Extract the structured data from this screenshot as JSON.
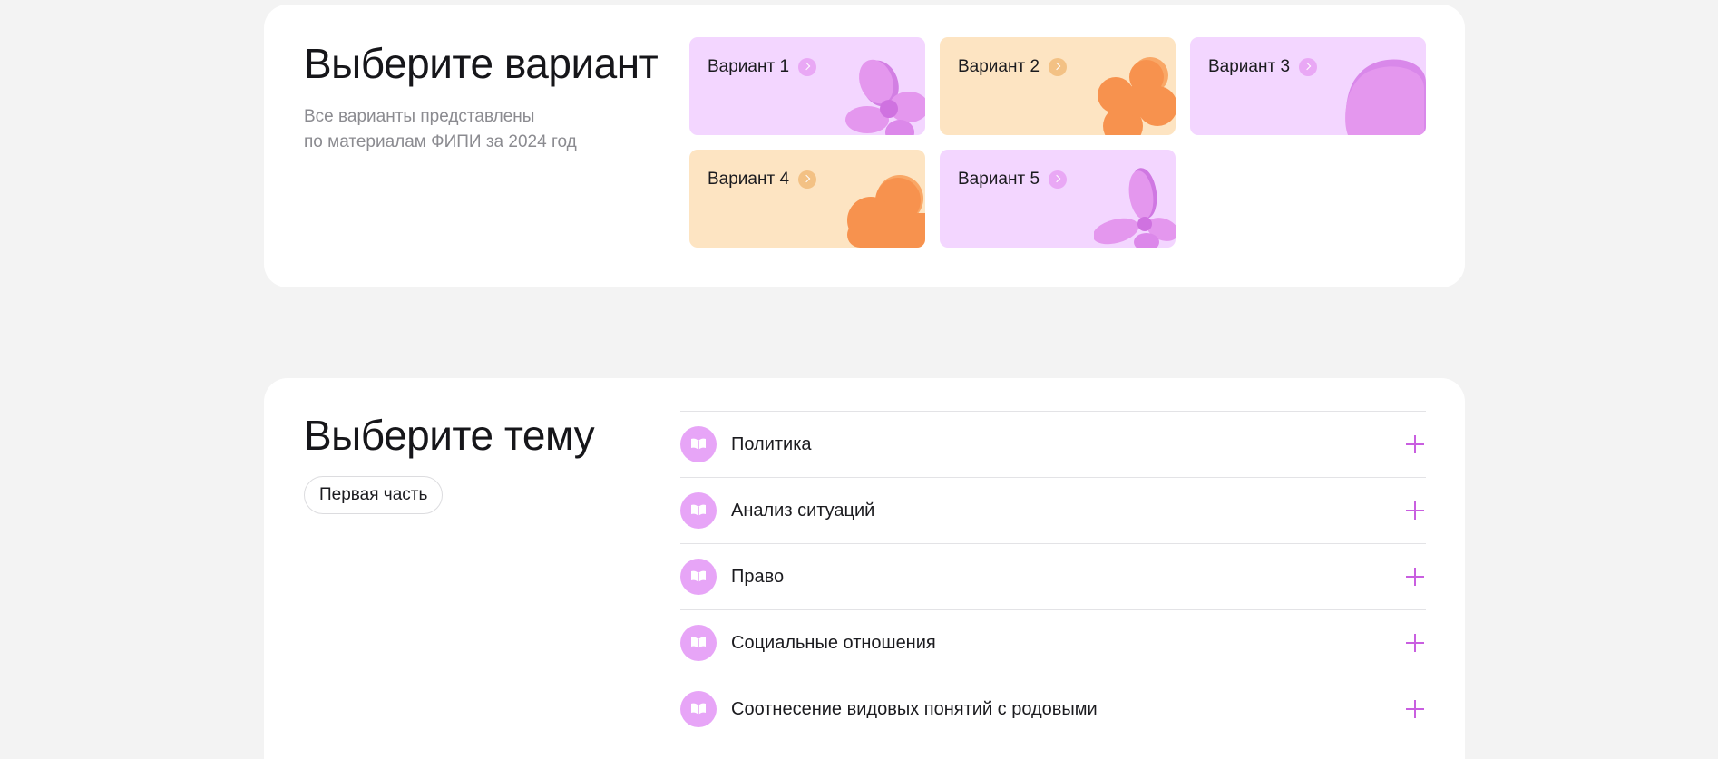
{
  "variants": {
    "title": "Выберите вариант",
    "subtitle_line1": "Все варианты представлены",
    "subtitle_line2": "по материалам ФИПИ за 2024 год",
    "tiles": [
      {
        "label": "Вариант 1",
        "theme": "pink",
        "shape": "flower-icon"
      },
      {
        "label": "Вариант 2",
        "theme": "peach",
        "shape": "flower-icon"
      },
      {
        "label": "Вариант 3",
        "theme": "pink",
        "shape": "blob-icon"
      },
      {
        "label": "Вариант 4",
        "theme": "peach",
        "shape": "cloud-icon"
      },
      {
        "label": "Вариант 5",
        "theme": "pink",
        "shape": "clover-icon"
      }
    ]
  },
  "topics": {
    "title": "Выберите тему",
    "filter_label": "Первая часть",
    "items": [
      {
        "label": "Политика",
        "icon": "book-icon"
      },
      {
        "label": "Анализ ситуаций",
        "icon": "book-icon"
      },
      {
        "label": "Право",
        "icon": "book-icon"
      },
      {
        "label": "Социальные отношения",
        "icon": "book-icon"
      },
      {
        "label": "Соотнесение видовых понятий с родовыми",
        "icon": "book-icon"
      }
    ]
  },
  "colors": {
    "page_bg": "#f3f3f3",
    "card_bg": "#ffffff",
    "tile_pink": "#f3d6ff",
    "tile_peach": "#fde4c2",
    "shape_pink": "#e497ee",
    "shape_orange": "#f7924e",
    "accent_purple": "#c95fe0",
    "icon_circle": "#e7a5f7"
  }
}
